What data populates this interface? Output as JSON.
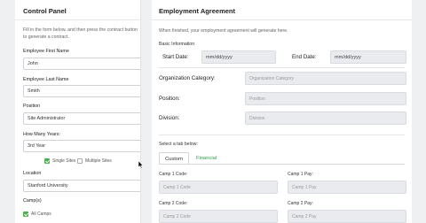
{
  "control": {
    "title": "Control Panel",
    "help": "Fill in the form below, and then press the contract button to generate a contract.",
    "first_name_label": "Employee First Name",
    "first_name_value": "John",
    "last_name_label": "Employee Last Name",
    "last_name_value": "Smith",
    "position_label": "Position",
    "position_value": "Site Administrator",
    "years_label": "How Many Years:",
    "years_value": "3rd Year",
    "single_sites": "Single Sites",
    "multiple_sites": "Multiple Sites",
    "location_label": "Location",
    "location_value": "Stanford University",
    "camps_label": "Camp(s)",
    "all_camps": "All Camps"
  },
  "agreement": {
    "title": "Employment Agreement",
    "help": "When finished, your employment agreement will generate here.",
    "basic_info": "Basic Information",
    "start_date_label": "Start Date:",
    "start_date_value": "mm/dd/yyyy",
    "end_date_label": "End Date:",
    "end_date_value": "mm/dd/yyyy",
    "org_category_label": "Organization Category:",
    "org_category_placeholder": "Organization Category",
    "position_label": "Position:",
    "position_placeholder": "Position",
    "division_label": "Division:",
    "division_placeholder": "Division",
    "select_tab": "Select a tab below:",
    "tabs": [
      "Custom",
      "Financial"
    ],
    "camp1_code_label": "Camp 1 Code:",
    "camp1_code_placeholder": "Camp 1 Code",
    "camp1_pay_label": "Camp 1 Pay:",
    "camp1_pay_placeholder": "Camp 1 Pay",
    "camp2_code_label": "Camp 2 Code:",
    "camp2_code_placeholder": "Camp 2 Code",
    "camp2_pay_label": "Camp 2 Pay:",
    "camp2_pay_placeholder": "Camp 2 Pay"
  },
  "colors": {
    "accent_green": "#4caf50",
    "link_green": "#2e9e45",
    "field_grey": "#e9ebee"
  }
}
